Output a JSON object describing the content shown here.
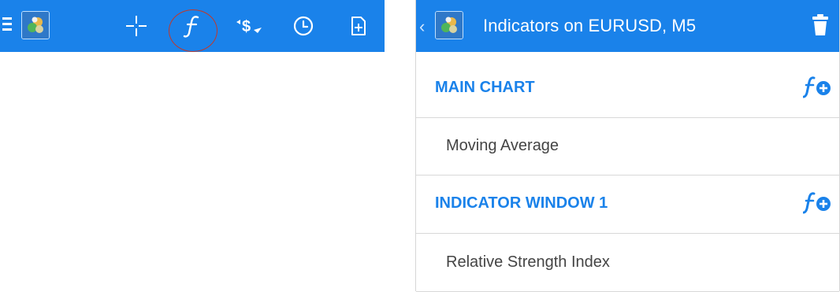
{
  "toolbar": {
    "icons": [
      "menu-icon",
      "app-logo",
      "crosshair-icon",
      "function-icon",
      "currency-icon",
      "clock-icon",
      "new-document-icon"
    ],
    "accent": "#1a82ea",
    "highlight_color": "#c0392b"
  },
  "panel": {
    "title": "Indicators on EURUSD, M5",
    "sections": [
      {
        "title": "MAIN CHART",
        "items": [
          "Moving Average"
        ]
      },
      {
        "title": "INDICATOR WINDOW 1",
        "items": [
          "Relative Strength Index"
        ]
      }
    ]
  }
}
